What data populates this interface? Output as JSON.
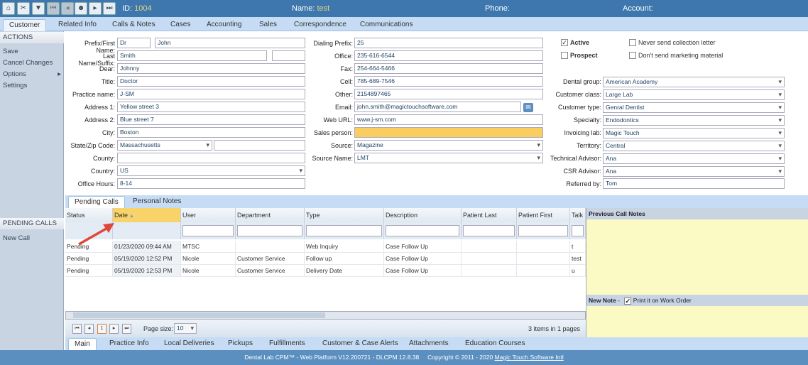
{
  "toolbar": {
    "id_label": "ID:",
    "id_value": "1004",
    "name_label": "Name:",
    "name_value": "test",
    "phone_label": "Phone:",
    "account_label": "Account:",
    "icons": [
      "home-icon",
      "tools-icon",
      "filter-icon",
      "first-icon",
      "prev-icon",
      "contacts-icon",
      "next-icon",
      "last-icon"
    ]
  },
  "tabs": [
    "Customer",
    "Related Info",
    "Calls & Notes",
    "Cases",
    "Accounting",
    "Sales",
    "Correspondence",
    "Communications"
  ],
  "sidebar": {
    "actions_header": "ACTIONS",
    "actions": [
      "Save",
      "Cancel Changes",
      "Options",
      "Settings"
    ],
    "pending_header": "PENDING CALLS",
    "pending": [
      "New Call"
    ]
  },
  "form": {
    "prefix_label": "Prefix/First Name:",
    "prefix": "Dr",
    "first": "John",
    "last_label": "Last Name/Suffix:",
    "last": "Smith",
    "suffix": "",
    "dear_label": "Dear:",
    "dear": "Johnny",
    "title_label": "Title:",
    "title": "Doctor",
    "practice_label": "Practice name:",
    "practice": "J-SM",
    "addr1_label": "Address 1:",
    "addr1": "Yellow street 3",
    "addr2_label": "Address 2:",
    "addr2": "Blue street 7",
    "city_label": "City:",
    "city": "Boston",
    "state_label": "State/Zip Code:",
    "state": "Massachusetts",
    "zip": "",
    "county_label": "County:",
    "county": "",
    "country_label": "Country:",
    "country": "US",
    "hours_label": "Office Hours:",
    "hours": "8-14",
    "dial_label": "Dialing Prefix:",
    "dial": "25",
    "office_label": "Office:",
    "office": "235-616-6544",
    "fax_label": "Fax:",
    "fax": "254-664-5466",
    "cell_label": "Cell:",
    "cell": "785-689-7546",
    "other_label": "Other:",
    "other": "2154897465",
    "email_label": "Email:",
    "email": "john.smith@magictouchsoftware.com",
    "web_label": "Web URL:",
    "web": "www.j-sm.com",
    "sales_label": "Sales person:",
    "sales": "",
    "source_label": "Source:",
    "source": "Magazine",
    "source_name_label": "Source Name:",
    "source_name": "LMT",
    "active_label": "Active",
    "active": true,
    "prospect_label": "Prospect",
    "prospect": false,
    "never_send_label": "Never send collection letter",
    "never_send": false,
    "no_marketing_label": "Don't send marketing material",
    "no_marketing": false,
    "dental_group_label": "Dental group:",
    "dental_group": "American Academy",
    "class_label": "Customer class:",
    "class": "Large Lab",
    "type_label": "Customer type:",
    "type": "Genral Dentist",
    "specialty_label": "Specialty:",
    "specialty": "Endodontics",
    "invoicing_label": "Invoicing lab:",
    "invoicing": "Magic Touch",
    "territory_label": "Territory:",
    "territory": "Central",
    "tech_label": "Technical Advisor:",
    "tech": "Ana",
    "csr_label": "CSR Advisor:",
    "csr": "Ana",
    "referred_label": "Referred by:",
    "referred": "Tom",
    "sales_color": "#f9cd5e"
  },
  "panel_tabs": [
    "Pending Calls",
    "Personal Notes"
  ],
  "grid": {
    "columns": [
      "Status",
      "Date",
      "User",
      "Department",
      "Type",
      "Description",
      "Patient Last",
      "Patient First",
      "Talk T"
    ],
    "rows": [
      [
        "Pending",
        "01/23/2020 09:44 AM",
        "MTSC",
        "",
        "Web Inquiry",
        "Case Follow Up",
        "",
        "",
        "t"
      ],
      [
        "Pending",
        "05/19/2020 12:52 PM",
        "Nicole",
        "Customer Service",
        "Follow up",
        "Case Follow Up",
        "",
        "",
        "test"
      ],
      [
        "Pending",
        "05/19/2020 12:53 PM",
        "Nicole",
        "Customer Service",
        "Delivery Date",
        "Case Follow Up",
        "",
        "",
        "u"
      ]
    ]
  },
  "pager": {
    "page": "1",
    "page_size_label": "Page size:",
    "page_size": "10",
    "summary": "3 items in 1 pages"
  },
  "notes": {
    "previous_title": "Previous Call Notes",
    "new_title": "New Note",
    "dash": "-",
    "print_label": "Print it on Work Order",
    "print": true
  },
  "bottom_tabs": [
    "Main",
    "Practice Info",
    "Local Deliveries",
    "Pickups",
    "Fulfillments",
    "Customer & Case Alerts",
    "Attachments",
    "Education Courses"
  ],
  "footer": {
    "text": "Dental Lab CPM™ - Web Platform V12.200721 - DLCPM 12.8.38",
    "copyright": "Copyright © 2011 - 2020",
    "link": "Magic Touch Software Intl"
  }
}
